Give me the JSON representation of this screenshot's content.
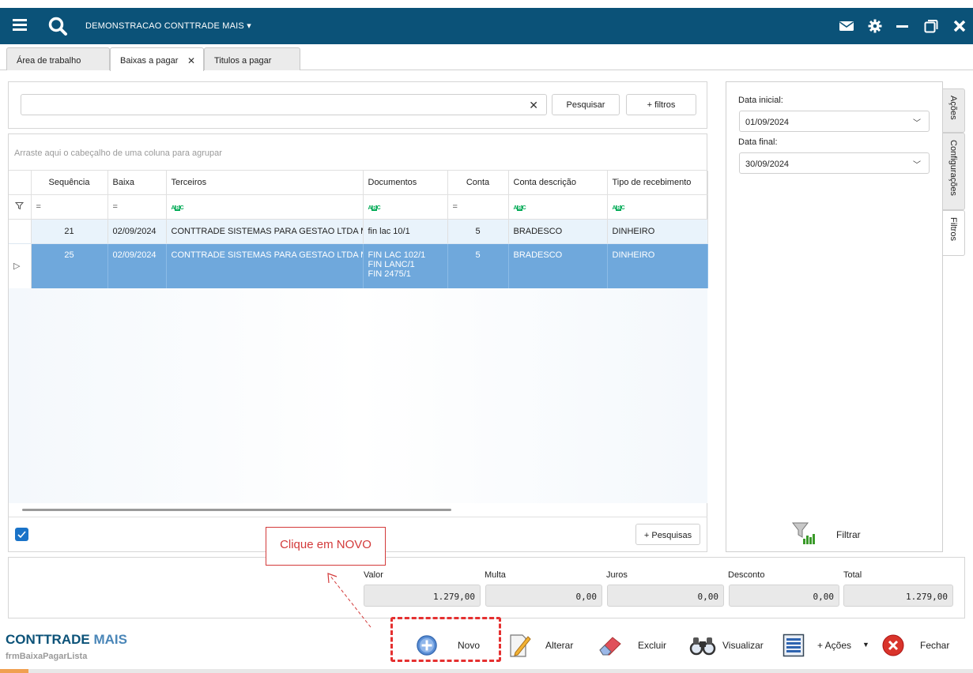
{
  "header": {
    "company": "DEMONSTRACAO CONTTRADE MAIS"
  },
  "tabs": [
    {
      "label": "Área de trabalho"
    },
    {
      "label": "Baixas a pagar"
    },
    {
      "label": "Titulos a pagar"
    }
  ],
  "search": {
    "value": "",
    "pesquisar_label": "Pesquisar",
    "filtros_label": "+ filtros"
  },
  "grid": {
    "group_hint": "Arraste aqui o cabeçalho de uma coluna para agrupar",
    "columns": [
      "Sequência",
      "Baixa",
      "Terceiros",
      "Documentos",
      "Conta",
      "Conta descrição",
      "Tipo de recebimento"
    ],
    "filter_eq": "=",
    "rows": [
      {
        "sequencia": "21",
        "baixa": "02/09/2024",
        "terceiros": "CONTTRADE SISTEMAS PARA GESTAO LTDA ME",
        "documentos": [
          "fin lac 10/1"
        ],
        "conta": "5",
        "conta_descricao": "BRADESCO",
        "tipo": "DINHEIRO"
      },
      {
        "sequencia": "25",
        "baixa": "02/09/2024",
        "terceiros": "CONTTRADE SISTEMAS PARA GESTAO LTDA ME",
        "documentos": [
          "FIN LAC 102/1",
          "FIN LANC/1",
          "FIN 2475/1"
        ],
        "conta": "5",
        "conta_descricao": "BRADESCO",
        "tipo": "DINHEIRO"
      }
    ],
    "pesquisas_label": "+ Pesquisas"
  },
  "filters": {
    "data_inicial_label": "Data inicial:",
    "data_inicial": "01/09/2024",
    "data_final_label": "Data final:",
    "data_final": "30/09/2024",
    "filtrar_label": "Filtrar"
  },
  "side_tabs": [
    "Ações",
    "Configurações",
    "Filtros"
  ],
  "totals": {
    "valor_label": "Valor",
    "valor": "1.279,00",
    "multa_label": "Multa",
    "multa": "0,00",
    "juros_label": "Juros",
    "juros": "0,00",
    "desconto_label": "Desconto",
    "desconto": "0,00",
    "total_label": "Total",
    "total": "1.279,00"
  },
  "footer": {
    "brand_main": "CONTTRADE",
    "brand_accent": " MAIS",
    "form_name": "frmBaixaPagarLista",
    "actions": {
      "novo": "Novo",
      "alterar": "Alterar",
      "excluir": "Excluir",
      "visualizar": "Visualizar",
      "acoes": "+ Ações",
      "fechar": "Fechar"
    }
  },
  "annotation": {
    "callout": "Clique em NOVO"
  },
  "colors": {
    "topbar": "#0b5278",
    "selected_row": "#6fa8dc",
    "callout": "#d33a3a"
  }
}
